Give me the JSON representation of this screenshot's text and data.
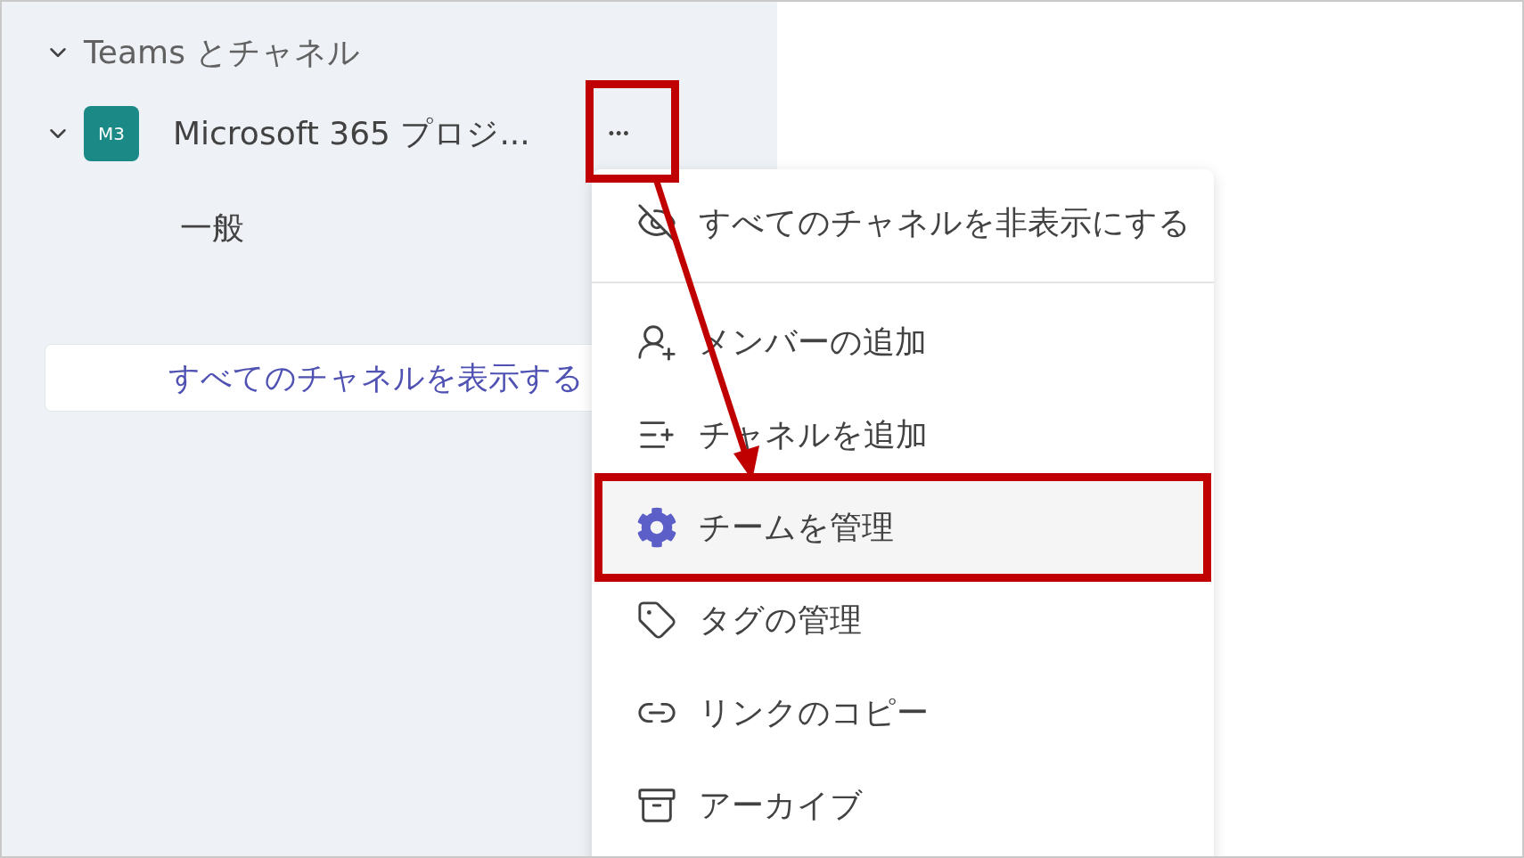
{
  "sidebar": {
    "header": {
      "label": "Teams とチャネル",
      "expanded": true
    },
    "team": {
      "avatar": "M3",
      "name": "Microsoft 365 プロジ...",
      "expanded": true,
      "more_button": {
        "label": "•••",
        "annotated": true
      },
      "channels": [
        {
          "label": "一般"
        }
      ]
    },
    "show_all_link": "すべてのチャネルを表示する"
  },
  "menu": {
    "sections": [
      [
        {
          "label": "すべてのチャネルを非表示にする",
          "selected": false
        }
      ],
      [
        {
          "label": "メンバーの追加",
          "selected": false
        },
        {
          "label": "チャネルを追加",
          "selected": false
        },
        {
          "label": "チームを管理",
          "selected": true
        },
        {
          "label": "タグの管理",
          "selected": false
        },
        {
          "label": "リンクのコピー",
          "selected": false
        },
        {
          "label": "アーカイブ",
          "selected": false
        }
      ]
    ]
  }
}
